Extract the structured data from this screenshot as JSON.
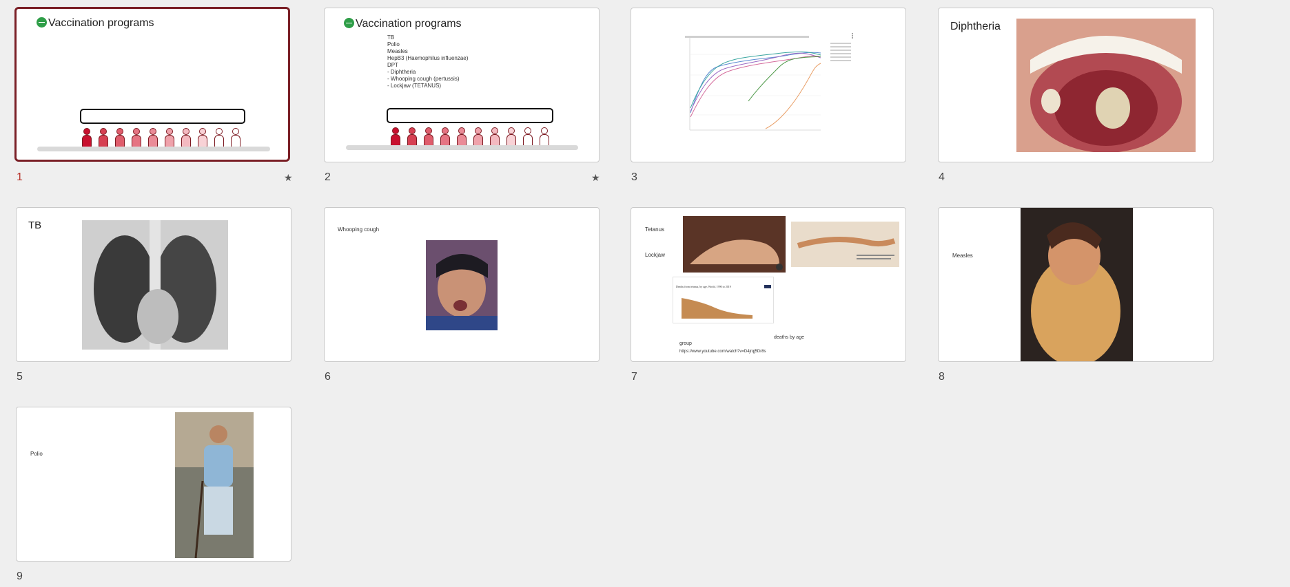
{
  "slides": [
    {
      "number": "1",
      "title": "Vaccination programs",
      "selected": true,
      "starred": true
    },
    {
      "number": "2",
      "title": "Vaccination programs",
      "starred": true,
      "lines": [
        "TB",
        "Polio",
        "Measles",
        "HepB3 (Haemophilus influenzae)",
        "DPT",
        "- Diphtheria",
        "- Whooping cough (pertussis)",
        "- Lockjaw (TETANUS)"
      ]
    },
    {
      "number": "3"
    },
    {
      "number": "4",
      "title": "Diphtheria"
    },
    {
      "number": "5",
      "title": "TB"
    },
    {
      "number": "6",
      "title": "Whooping cough"
    },
    {
      "number": "7",
      "labels": [
        "Tetanus",
        "Lockjaw"
      ],
      "caption1": "deaths by age",
      "caption2": "group",
      "url": "https://www.youtube.com/watch?v=D4jrqj5Dr8s",
      "chart_title": "Deaths from tetanus, by age, World, 1990 to 2019"
    },
    {
      "number": "8",
      "title": "Measles"
    },
    {
      "number": "9",
      "title": "Polio"
    }
  ],
  "star_glyph": "★",
  "colors": {
    "selected_border": "#7a1f26",
    "active_number": "#b8342b"
  }
}
